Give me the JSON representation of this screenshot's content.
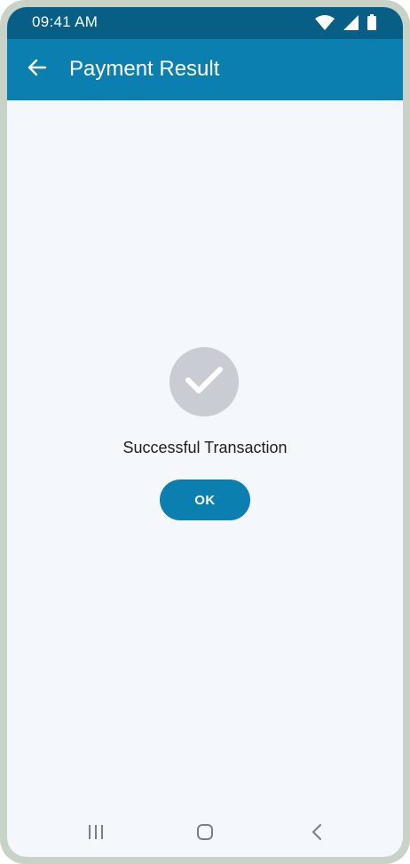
{
  "status_bar": {
    "time": "09:41 AM",
    "icons": [
      "wifi-icon",
      "signal-icon",
      "battery-icon"
    ]
  },
  "app_bar": {
    "back_icon": "arrow-left-icon",
    "title": "Payment Result"
  },
  "result": {
    "icon": "checkmark-icon",
    "message": "Successful Transaction",
    "ok_label": "OK"
  },
  "nav_bar": {
    "items": [
      "recent-apps-icon",
      "home-icon",
      "back-icon"
    ]
  },
  "colors": {
    "status_bar": "#075f86",
    "app_bar": "#0a7fb0",
    "primary": "#0a7fb0",
    "background": "#f4f7fc",
    "success_circle": "#c9ccd3"
  }
}
